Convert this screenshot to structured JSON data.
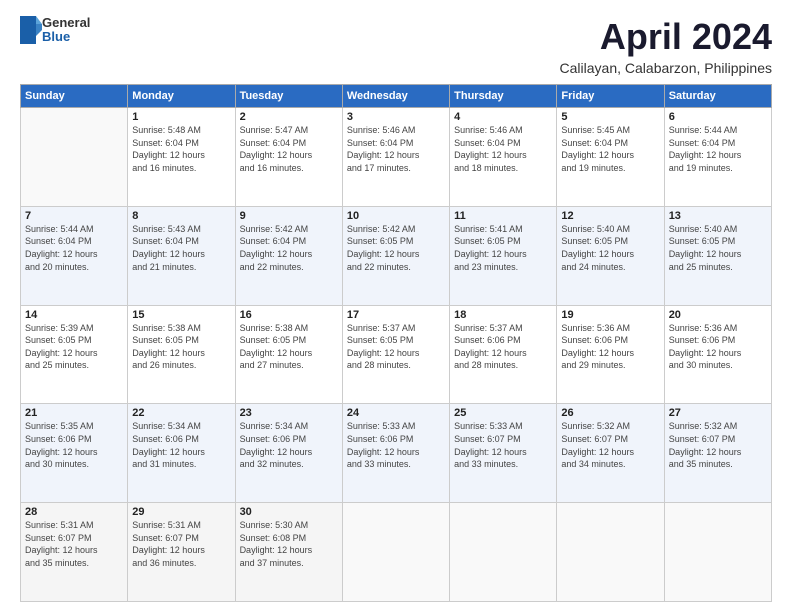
{
  "logo": {
    "general": "General",
    "blue": "Blue"
  },
  "title": "April 2024",
  "location": "Calilayan, Calabarzon, Philippines",
  "weekdays": [
    "Sunday",
    "Monday",
    "Tuesday",
    "Wednesday",
    "Thursday",
    "Friday",
    "Saturday"
  ],
  "weeks": [
    [
      {
        "day": "",
        "info": ""
      },
      {
        "day": "1",
        "info": "Sunrise: 5:48 AM\nSunset: 6:04 PM\nDaylight: 12 hours\nand 16 minutes."
      },
      {
        "day": "2",
        "info": "Sunrise: 5:47 AM\nSunset: 6:04 PM\nDaylight: 12 hours\nand 16 minutes."
      },
      {
        "day": "3",
        "info": "Sunrise: 5:46 AM\nSunset: 6:04 PM\nDaylight: 12 hours\nand 17 minutes."
      },
      {
        "day": "4",
        "info": "Sunrise: 5:46 AM\nSunset: 6:04 PM\nDaylight: 12 hours\nand 18 minutes."
      },
      {
        "day": "5",
        "info": "Sunrise: 5:45 AM\nSunset: 6:04 PM\nDaylight: 12 hours\nand 19 minutes."
      },
      {
        "day": "6",
        "info": "Sunrise: 5:44 AM\nSunset: 6:04 PM\nDaylight: 12 hours\nand 19 minutes."
      }
    ],
    [
      {
        "day": "7",
        "info": "Sunrise: 5:44 AM\nSunset: 6:04 PM\nDaylight: 12 hours\nand 20 minutes."
      },
      {
        "day": "8",
        "info": "Sunrise: 5:43 AM\nSunset: 6:04 PM\nDaylight: 12 hours\nand 21 minutes."
      },
      {
        "day": "9",
        "info": "Sunrise: 5:42 AM\nSunset: 6:04 PM\nDaylight: 12 hours\nand 22 minutes."
      },
      {
        "day": "10",
        "info": "Sunrise: 5:42 AM\nSunset: 6:05 PM\nDaylight: 12 hours\nand 22 minutes."
      },
      {
        "day": "11",
        "info": "Sunrise: 5:41 AM\nSunset: 6:05 PM\nDaylight: 12 hours\nand 23 minutes."
      },
      {
        "day": "12",
        "info": "Sunrise: 5:40 AM\nSunset: 6:05 PM\nDaylight: 12 hours\nand 24 minutes."
      },
      {
        "day": "13",
        "info": "Sunrise: 5:40 AM\nSunset: 6:05 PM\nDaylight: 12 hours\nand 25 minutes."
      }
    ],
    [
      {
        "day": "14",
        "info": "Sunrise: 5:39 AM\nSunset: 6:05 PM\nDaylight: 12 hours\nand 25 minutes."
      },
      {
        "day": "15",
        "info": "Sunrise: 5:38 AM\nSunset: 6:05 PM\nDaylight: 12 hours\nand 26 minutes."
      },
      {
        "day": "16",
        "info": "Sunrise: 5:38 AM\nSunset: 6:05 PM\nDaylight: 12 hours\nand 27 minutes."
      },
      {
        "day": "17",
        "info": "Sunrise: 5:37 AM\nSunset: 6:05 PM\nDaylight: 12 hours\nand 28 minutes."
      },
      {
        "day": "18",
        "info": "Sunrise: 5:37 AM\nSunset: 6:06 PM\nDaylight: 12 hours\nand 28 minutes."
      },
      {
        "day": "19",
        "info": "Sunrise: 5:36 AM\nSunset: 6:06 PM\nDaylight: 12 hours\nand 29 minutes."
      },
      {
        "day": "20",
        "info": "Sunrise: 5:36 AM\nSunset: 6:06 PM\nDaylight: 12 hours\nand 30 minutes."
      }
    ],
    [
      {
        "day": "21",
        "info": "Sunrise: 5:35 AM\nSunset: 6:06 PM\nDaylight: 12 hours\nand 30 minutes."
      },
      {
        "day": "22",
        "info": "Sunrise: 5:34 AM\nSunset: 6:06 PM\nDaylight: 12 hours\nand 31 minutes."
      },
      {
        "day": "23",
        "info": "Sunrise: 5:34 AM\nSunset: 6:06 PM\nDaylight: 12 hours\nand 32 minutes."
      },
      {
        "day": "24",
        "info": "Sunrise: 5:33 AM\nSunset: 6:06 PM\nDaylight: 12 hours\nand 33 minutes."
      },
      {
        "day": "25",
        "info": "Sunrise: 5:33 AM\nSunset: 6:07 PM\nDaylight: 12 hours\nand 33 minutes."
      },
      {
        "day": "26",
        "info": "Sunrise: 5:32 AM\nSunset: 6:07 PM\nDaylight: 12 hours\nand 34 minutes."
      },
      {
        "day": "27",
        "info": "Sunrise: 5:32 AM\nSunset: 6:07 PM\nDaylight: 12 hours\nand 35 minutes."
      }
    ],
    [
      {
        "day": "28",
        "info": "Sunrise: 5:31 AM\nSunset: 6:07 PM\nDaylight: 12 hours\nand 35 minutes."
      },
      {
        "day": "29",
        "info": "Sunrise: 5:31 AM\nSunset: 6:07 PM\nDaylight: 12 hours\nand 36 minutes."
      },
      {
        "day": "30",
        "info": "Sunrise: 5:30 AM\nSunset: 6:08 PM\nDaylight: 12 hours\nand 37 minutes."
      },
      {
        "day": "",
        "info": ""
      },
      {
        "day": "",
        "info": ""
      },
      {
        "day": "",
        "info": ""
      },
      {
        "day": "",
        "info": ""
      }
    ]
  ]
}
